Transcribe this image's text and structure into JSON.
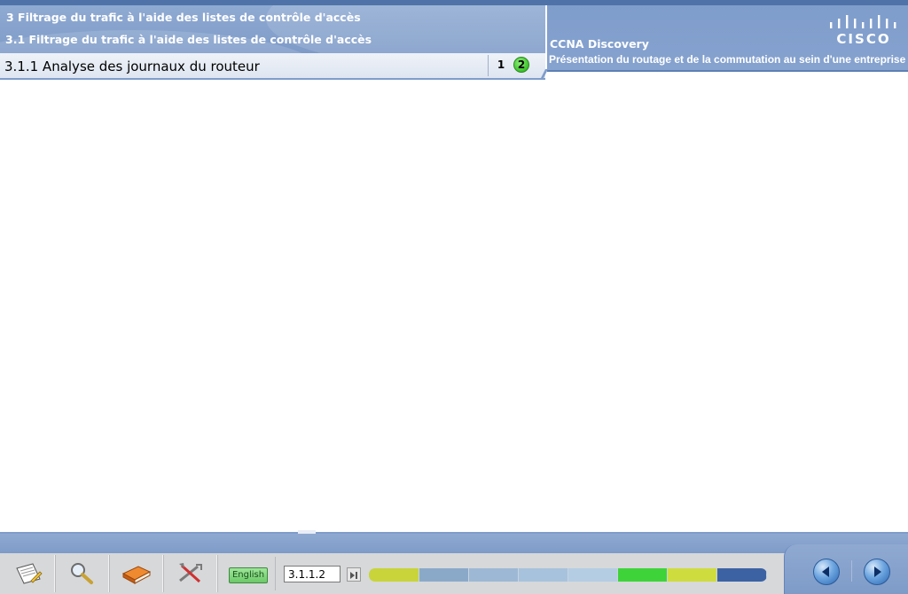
{
  "header": {
    "chapter": "3 Filtrage du trafic à l'aide des listes de contrôle d'accès",
    "section": "3.1 Filtrage du trafic à l'aide des listes de contrôle d'accès",
    "course_name": "CCNA Discovery",
    "course_subtitle": "Présentation du routage et de la commutation au sein d'une entreprise",
    "logo_text": "CISCO"
  },
  "topic": {
    "title": "3.1.1 Analyse des journaux du routeur",
    "pages": [
      "1",
      "2"
    ],
    "current_page": "2"
  },
  "toolbar": {
    "language": "English",
    "page_field_value": "3.1.1.2",
    "tools": [
      "notes-icon",
      "search-icon",
      "glossary-book-icon",
      "tools-icon"
    ]
  },
  "progress": {
    "segments": [
      {
        "color": "#c8d43a"
      },
      {
        "color": "#8aa9c9"
      },
      {
        "color": "#9db8d4"
      },
      {
        "color": "#a7c2dc"
      },
      {
        "color": "#b4cde3"
      },
      {
        "color": "#3fd33a"
      },
      {
        "color": "#cfdc3e"
      },
      {
        "color": "#3c62a3"
      }
    ]
  },
  "colors": {
    "header_blue": "#7f9dcb",
    "topic_bar": "#e4eaf3",
    "footer_gray": "#d7d8da",
    "current_page_green": "#3cc22a"
  }
}
